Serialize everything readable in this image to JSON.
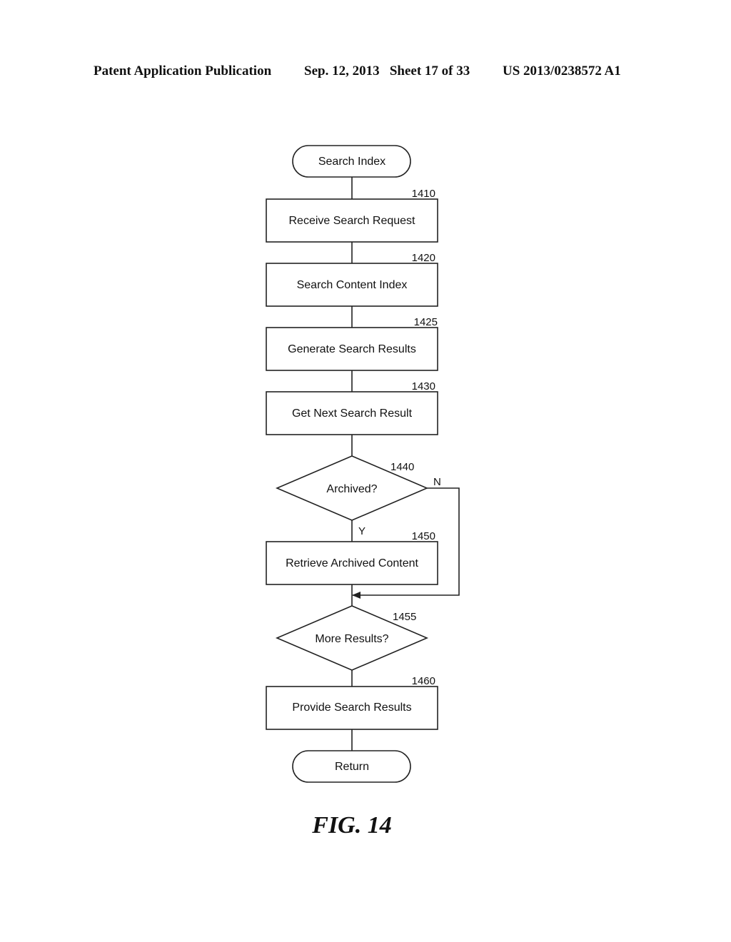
{
  "header": {
    "publication": "Patent Application Publication",
    "date_sheet": "Sep. 12, 2013   Sheet 17 of 33",
    "patent_number": "US 2013/0238572 A1"
  },
  "flowchart": {
    "start": {
      "label": "Search Index"
    },
    "steps": [
      {
        "id": "1410",
        "label": "Receive Search Request",
        "shape": "process"
      },
      {
        "id": "1420",
        "label": "Search Content Index",
        "shape": "process"
      },
      {
        "id": "1425",
        "label": "Generate Search Results",
        "shape": "process"
      },
      {
        "id": "1430",
        "label": "Get Next Search Result",
        "shape": "process"
      },
      {
        "id": "1440",
        "label": "Archived?",
        "shape": "decision",
        "yes_label": "Y",
        "no_label": "N"
      },
      {
        "id": "1450",
        "label": "Retrieve Archived Content",
        "shape": "process"
      },
      {
        "id": "1455",
        "label": "More Results?",
        "shape": "decision"
      },
      {
        "id": "1460",
        "label": "Provide Search Results",
        "shape": "process"
      }
    ],
    "end": {
      "label": "Return"
    }
  },
  "figure_label": "FIG. 14"
}
